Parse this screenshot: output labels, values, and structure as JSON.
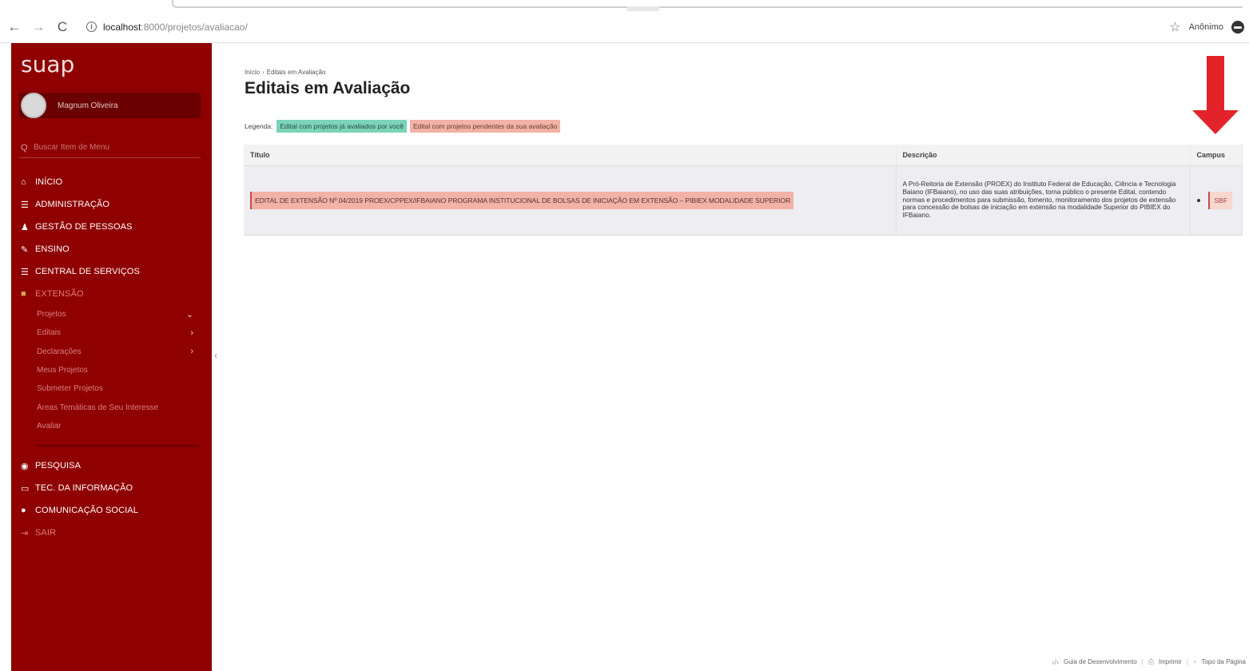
{
  "browser": {
    "url_host": "localhost",
    "url_path": ":8000/projetos/avaliacao/",
    "profile": "Anônimo"
  },
  "sidebar": {
    "logo": "suap",
    "username": "Magnum Oliveira",
    "search_placeholder": "Buscar Item de Menu",
    "menu": [
      {
        "label": "INÍCIO",
        "icon": "home-icon"
      },
      {
        "label": "ADMINISTRAÇÃO",
        "icon": "list-icon"
      },
      {
        "label": "GESTÃO DE PESSOAS",
        "icon": "people-icon"
      },
      {
        "label": "ENSINO",
        "icon": "pencil-icon"
      },
      {
        "label": "CENTRAL DE SERVIÇOS",
        "icon": "list-icon"
      },
      {
        "label": "EXTENSÃO",
        "icon": "briefcase-icon"
      }
    ],
    "submenu": [
      {
        "label": "Projetos",
        "chevron": "down"
      },
      {
        "label": "Editais",
        "chevron": "right"
      },
      {
        "label": "Declarações",
        "chevron": "right"
      },
      {
        "label": "Meus Projetos"
      },
      {
        "label": "Submeter Projetos"
      },
      {
        "label": "Áreas Temáticas de Seu Interesse"
      },
      {
        "label": "Avaliar"
      }
    ],
    "menu2": [
      {
        "label": "PESQUISA",
        "icon": "globe-icon"
      },
      {
        "label": "TEC. DA INFORMAÇÃO",
        "icon": "laptop-icon"
      },
      {
        "label": "COMUNICAÇÃO SOCIAL",
        "icon": "chat-icon"
      },
      {
        "label": "SAIR",
        "icon": "logout-icon"
      }
    ]
  },
  "main": {
    "breadcrumb_home": "Início",
    "breadcrumb_current": "Editais em Avaliação",
    "title": "Editais em Avaliação",
    "legend_label": "Legenda:",
    "legend_evaluated": "Edital com projetos já avaliados por você",
    "legend_pending": "Edital com projetos pendentes da sua avaliação",
    "columns": {
      "title": "Título",
      "description": "Descrição",
      "campus": "Campus"
    },
    "rows": [
      {
        "title": "EDITAL DE EXTENSÃO Nº 04/2019 PROEX/CPPEX/IFBAIANO PROGRAMA INSTITUCIONAL DE BOLSAS DE INICIAÇÃO EM EXTENSÃO – PIBIEX MODALIDADE SUPERIOR",
        "description": "A Pró-Reitoria de Extensão (PROEX) do Instituto Federal de Educação, Ciência e Tecnologia Baiano (IFBaiano), no uso das suas atribuições, torna público o presente Edital, contendo normas e procedimentos para submissão, fomento, monitoramento dos projetos de extensão para concessão de bolsas de iniciação em extensão na modalidade Superior do PIBIEX do IFBaiano.",
        "campus": "SBF"
      }
    ]
  },
  "footer": {
    "guide": "Guia de Desenvolvimento",
    "print": "Imprimir",
    "top": "Topo da Página"
  },
  "colors": {
    "sidebar": "#8f0000",
    "legend_green": "#7bd3b8",
    "legend_pink": "#f2b2a6",
    "arrow": "#e3232a"
  }
}
